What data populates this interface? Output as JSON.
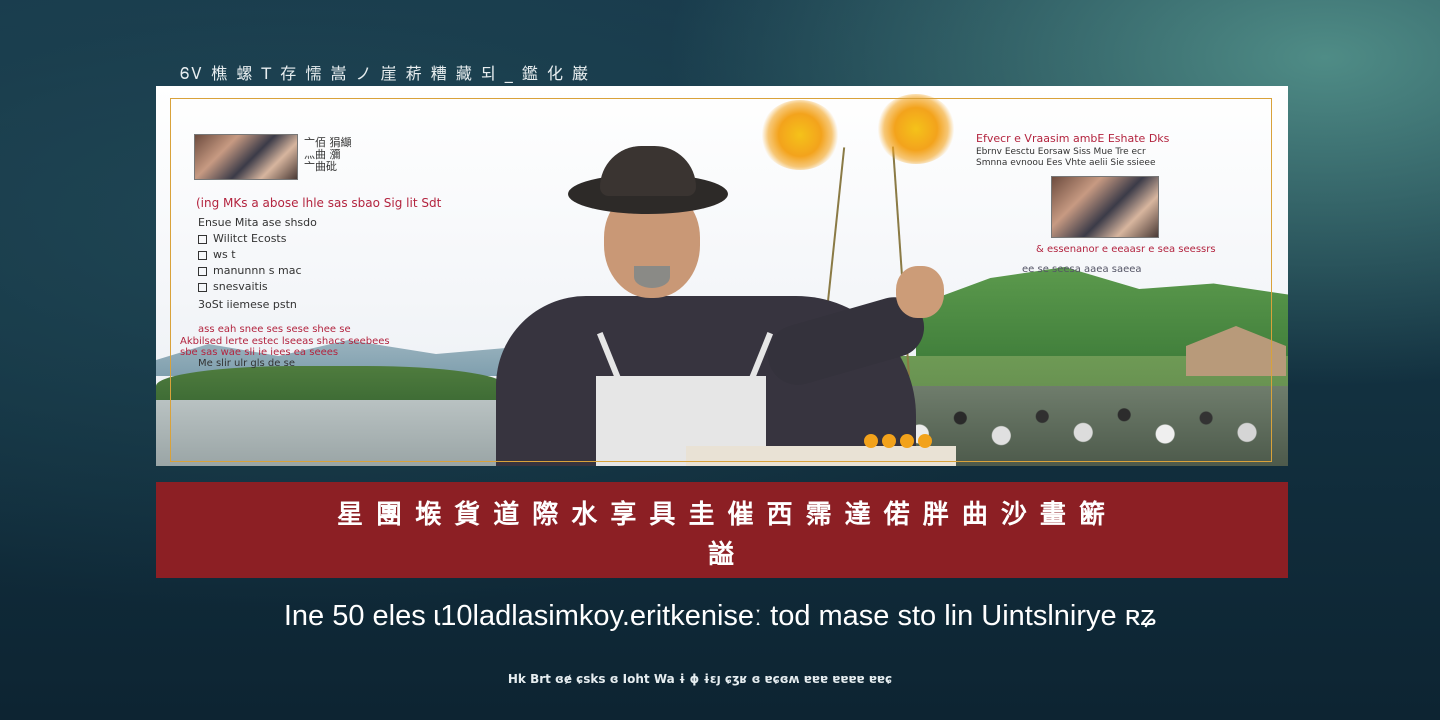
{
  "top_caption": "ᏮᏙ 樵 螺 T 存  懦 嵩 ノ 崖 菥 糟 藏 되 _ 鑑 化     巌",
  "poster": {
    "left_block": {
      "thumb_caption_1": "亠佰 狷纈",
      "thumb_caption_2": "灬曲 瀰",
      "thumb_caption_3": "亠曲砒",
      "headline": "(ing  MKs a  abose  lhle  sas  sbao  Sig lit  Sdt",
      "intro": "Ensue  Mita  ase  shsdo",
      "items": [
        "Wilitct Ecosts",
        "ws t",
        "manunnn s  mac",
        "snesvaitis",
        "3oSt iiemese pstn"
      ],
      "red_line_1": "ass  eah snee  ses  sese  shee  se",
      "red_line_2": "Akbilsed lerte  estec  lseeas  shacs  seebees",
      "red_line_3": "sbe  sas  wae  sli ie  iees  ea  seees",
      "red_line_4": "Me  slir ulr  gls  de se"
    },
    "right_block": {
      "headline": "Efvecr  e  Vraasim  ambE  Eshate  Dks",
      "sub": "Ebrnv Eesctu  Eorsaw  Siss  Mue  Tre  ecr",
      "sub2": "Smnna evnoou  Ees  Vhte  aelii  Sie  ssieee",
      "caption": "& essenanor  e  eeaasr  e  sea  seessrs",
      "caption2": "ee  se  seesa  aaea  saeea"
    }
  },
  "banner": {
    "row1": "星 團 堠 貨 道 際 水 享 具 圭 催 西 霈 達 偌 胖 曲 沙 畫 簖",
    "row2": "謚"
  },
  "subtitle": "Ine  50  eles  ɩ10ladlasimkoy.eritkeniseː  tod  mase sto  lin  Uintslnirye  ʀʑ",
  "footer": "Hk  Brt  ɞɇ  ɕsks  ɞ  Ioht  Wa ɨ ɸ  ɨɛȷ  ɕʒʁ ɞ  ɐɕɞʍ ɐɐɐ  ɐɐɐɐ ɐɐɕ"
}
